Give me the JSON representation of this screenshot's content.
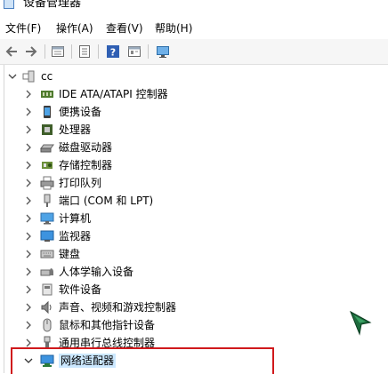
{
  "window": {
    "title": "设备管理器"
  },
  "menu": [
    "文件(F)",
    "操作(A)",
    "查看(V)",
    "帮助(H)"
  ],
  "toolbar_icons": [
    "back-icon",
    "forward-icon",
    "view-icon",
    "properties-icon",
    "help-icon",
    "view-icon",
    "monitor-icon"
  ],
  "tree": {
    "root": {
      "label": "cc",
      "expanded": true
    },
    "categories": [
      {
        "label": "IDE ATA/ATAPI 控制器",
        "icon": "ide-controller-icon"
      },
      {
        "label": "便携设备",
        "icon": "portable-device-icon"
      },
      {
        "label": "处理器",
        "icon": "processor-icon"
      },
      {
        "label": "磁盘驱动器",
        "icon": "disk-drive-icon"
      },
      {
        "label": "存储控制器",
        "icon": "storage-controller-icon"
      },
      {
        "label": "打印队列",
        "icon": "printer-icon"
      },
      {
        "label": "端口 (COM 和 LPT)",
        "icon": "port-icon"
      },
      {
        "label": "计算机",
        "icon": "computer-icon"
      },
      {
        "label": "监视器",
        "icon": "monitor-icon"
      },
      {
        "label": "键盘",
        "icon": "keyboard-icon"
      },
      {
        "label": "人体学输入设备",
        "icon": "hid-icon"
      },
      {
        "label": "软件设备",
        "icon": "software-device-icon"
      },
      {
        "label": "声音、视频和游戏控制器",
        "icon": "sound-icon"
      },
      {
        "label": "鼠标和其他指针设备",
        "icon": "mouse-icon"
      },
      {
        "label": "通用串行总线控制器",
        "icon": "usb-icon"
      },
      {
        "label": "网络适配器",
        "icon": "network-adapter-icon",
        "expanded": true,
        "selected": true
      }
    ]
  },
  "colors": {
    "highlight": "#cce8ff",
    "annotation_box": "#d0191c"
  }
}
